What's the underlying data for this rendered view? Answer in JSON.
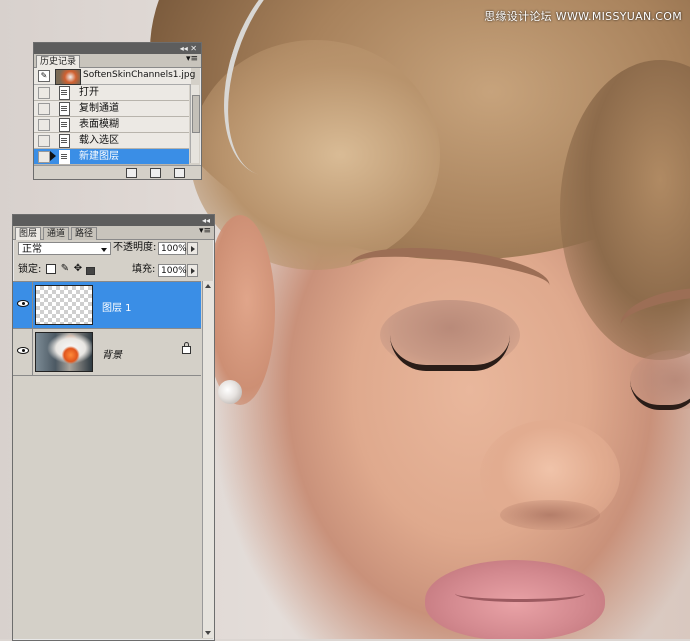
{
  "watermark": "思缘设计论坛 WWW.MISSYUAN.COM",
  "history_panel": {
    "collapse_glyph": "◂◂",
    "close_glyph": "✕",
    "menu_glyph": "▾≡",
    "tab_label": "历史记录",
    "snapshot_name": "SoftenSkinChannels1.jpg",
    "items": [
      {
        "label": "打开",
        "selected": false
      },
      {
        "label": "复制通道",
        "selected": false
      },
      {
        "label": "表面模糊",
        "selected": false
      },
      {
        "label": "载入选区",
        "selected": false
      },
      {
        "label": "新建图层",
        "selected": true
      }
    ],
    "footer_icons": [
      "new-document-from-state-icon",
      "new-snapshot-icon",
      "delete-state-icon"
    ]
  },
  "layers_panel": {
    "collapse_glyph": "◂◂",
    "menu_glyph": "▾≡",
    "tabs": [
      "图层",
      "通道",
      "路径"
    ],
    "active_tab": "图层",
    "blend_mode": "正常",
    "opacity_label": "不透明度:",
    "opacity_value": "100%",
    "lock_label": "锁定:",
    "fill_label": "填充:",
    "fill_value": "100%",
    "lock_icons": [
      "lock-transparency-icon",
      "lock-pixels-icon",
      "lock-position-icon",
      "lock-all-icon"
    ],
    "layers": [
      {
        "name": "图层 1",
        "visible": true,
        "selected": true,
        "thumbnail": "transparent"
      },
      {
        "name": "背景",
        "visible": true,
        "selected": false,
        "locked": true,
        "thumbnail": "bride-photo"
      }
    ]
  },
  "colors": {
    "selection_blue": "#3a8ee6",
    "panel_gray": "#d4d0c8",
    "titlebar": "#5d5d5d"
  }
}
